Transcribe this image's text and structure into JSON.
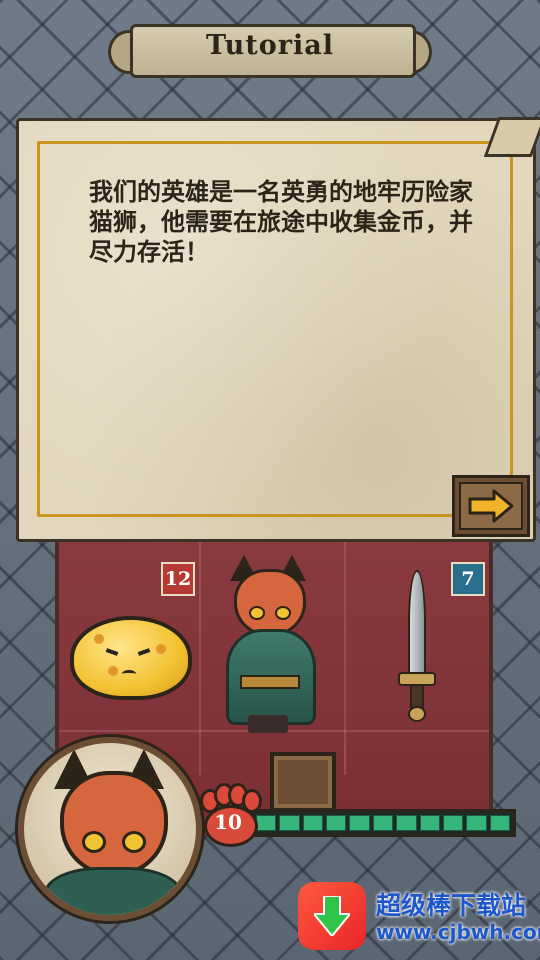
{
  "header": {
    "title": "Tutorial"
  },
  "dialog": {
    "message": "我们的英雄是一名英勇的地牢历险家猫狮，他需要在旅途中收集金币，并尽力存活！",
    "next_button": "arrow-right-icon"
  },
  "board": {
    "enemy": {
      "name": "slime",
      "stat": "12"
    },
    "weapon": {
      "name": "sword",
      "stat": "7"
    },
    "hero": {
      "name": "cat-hero"
    }
  },
  "hud": {
    "hp": "10",
    "hp_segments": 11,
    "hp_fraction": 1.0
  },
  "watermark": {
    "name": "超级棒下载站",
    "url": "www.cjbwh.com"
  },
  "colors": {
    "accent": "#c8961f",
    "board": "#8a3a3f",
    "hp_bar": "#36b57a",
    "stat_red": "#b53a33",
    "stat_blue": "#2b6f8f"
  }
}
